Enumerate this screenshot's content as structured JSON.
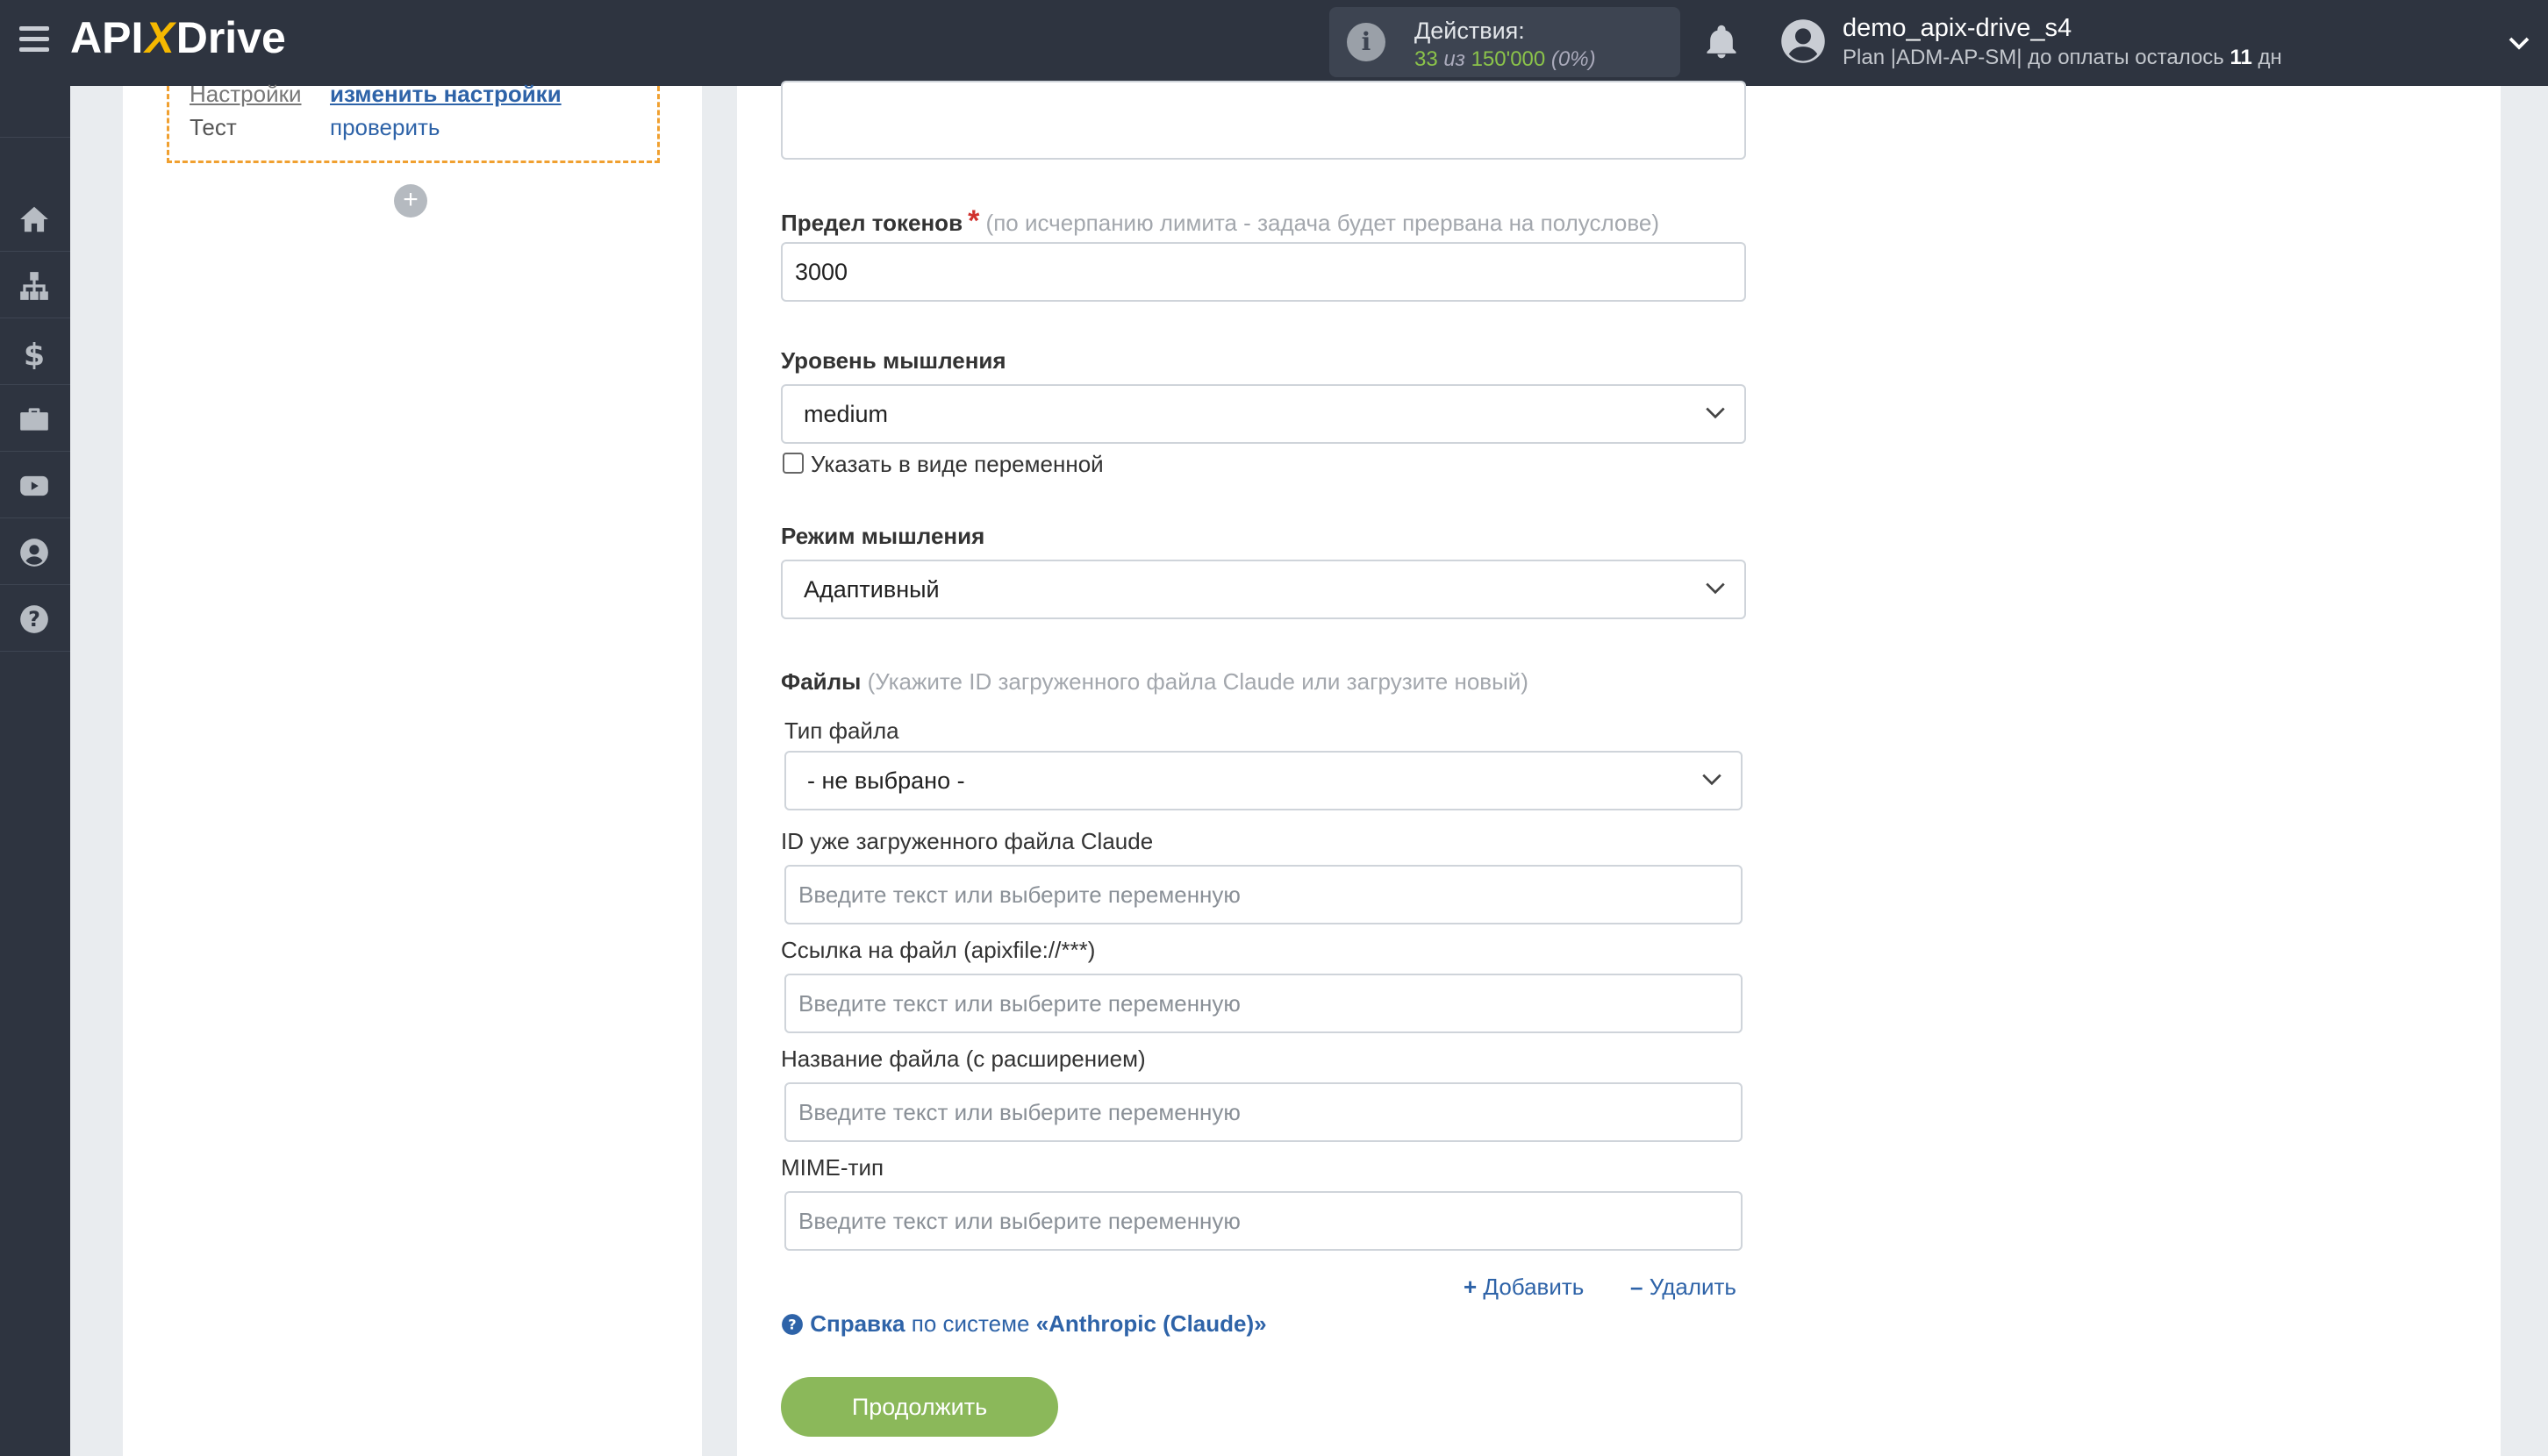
{
  "header": {
    "logo_left": "API",
    "logo_x": "X",
    "logo_right": "Drive",
    "actions_label": "Действия:",
    "actions_used": "33",
    "actions_of": "из",
    "actions_total": "150'000",
    "actions_pct": "(0%)",
    "user_name": "demo_apix-drive_s4",
    "plan_prefix": "Plan |ADM-AP-SM| до оплаты осталось",
    "plan_days": "11",
    "plan_suffix": "дн"
  },
  "sidebar": {
    "items": [
      "home-icon",
      "sitemap-icon",
      "dollar-icon",
      "briefcase-icon",
      "youtube-icon",
      "user-icon",
      "help-icon"
    ]
  },
  "left_panel": {
    "settings_label": "Настройки",
    "settings_link": "изменить настройки",
    "test_label": "Тест",
    "test_link": "проверить",
    "add_symbol": "+"
  },
  "form": {
    "token_limit_label": "Предел токенов",
    "required_mark": "*",
    "token_limit_hint": "(по исчерпанию лимита - задача будет прервана на полуслове)",
    "token_limit_value": "3000",
    "thinking_level_label": "Уровень мышления",
    "thinking_level_value": "medium",
    "as_variable_label": "Указать в виде переменной",
    "thinking_mode_label": "Режим мышления",
    "thinking_mode_value": "Адаптивный",
    "files_label": "Файлы",
    "files_hint": "(Укажите ID загруженного файла Claude или загрузите новый)",
    "file_type_label": "Тип файла",
    "file_type_value": "- не выбрано -",
    "file_id_label": "ID уже загруженного файла Claude",
    "file_link_label": "Ссылка на файл (apixfile://***)",
    "file_name_label": "Название файла (с расширением)",
    "mime_label": "MIME-тип",
    "placeholder": "Введите текст или выберите переменную",
    "add_label": "Добавить",
    "remove_label": "Удалить",
    "help_link": "Справка",
    "help_text": "по системе",
    "help_system": "«Anthropic (Claude)»",
    "continue_label": "Продолжить"
  },
  "colors": {
    "topbar": "#2e3440",
    "accent_green": "#8bb85a",
    "link_blue": "#2e63a8",
    "dashed_orange": "#f0a030"
  }
}
